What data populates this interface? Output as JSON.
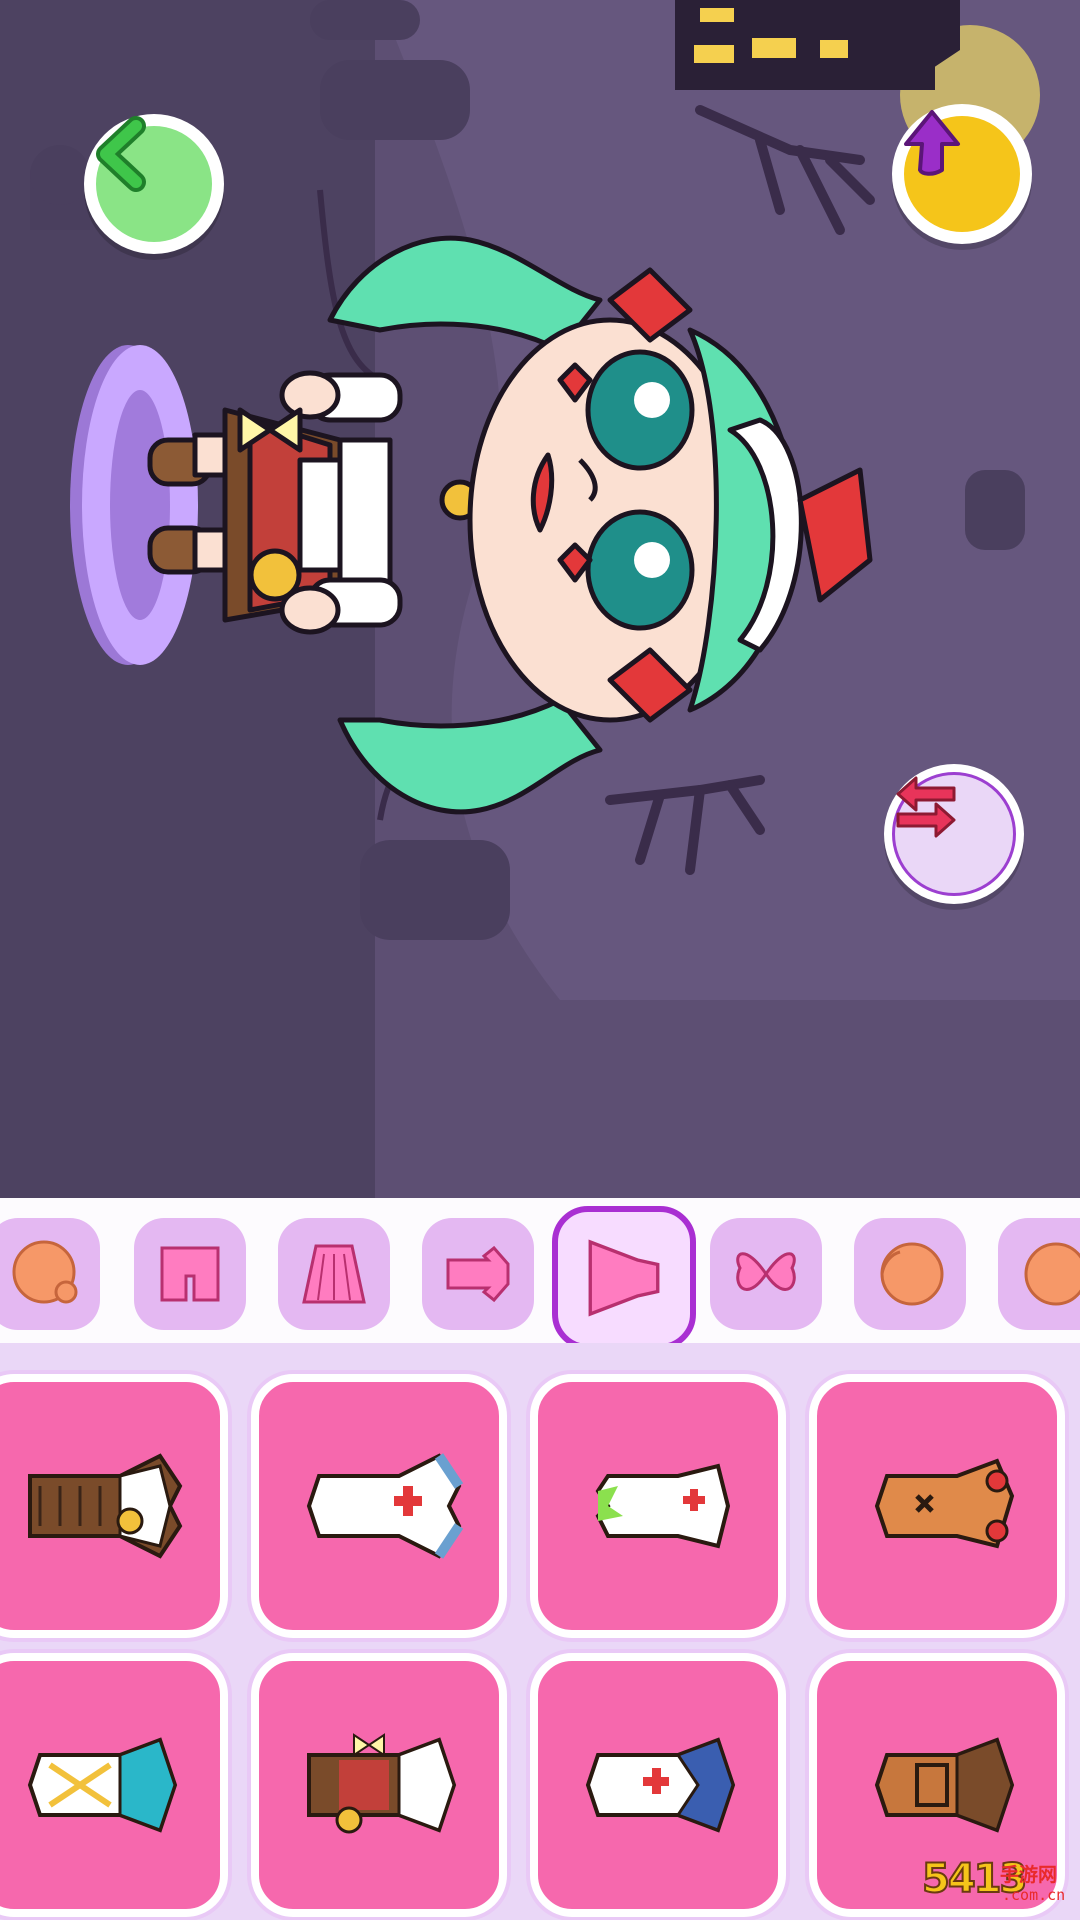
{
  "scene": {
    "back_button": {
      "icon": "chevron-left-icon",
      "color": "#3fc64a"
    },
    "share_button": {
      "icon": "arrow-up-icon",
      "color": "#9a2ec8"
    },
    "swap_button": {
      "icon": "swap-arrows-icon",
      "color": "#e8345a"
    },
    "character": {
      "hair_color": "#5fe0b0",
      "eye_color": "#1f8f8a",
      "ribbon_color": "#e3383a"
    }
  },
  "category_tabs": [
    {
      "name": "face",
      "icon": "face-icon",
      "active": false
    },
    {
      "name": "shorts",
      "icon": "shorts-icon",
      "active": false
    },
    {
      "name": "skirt",
      "icon": "skirt-icon",
      "active": false
    },
    {
      "name": "top",
      "icon": "shirt-icon",
      "active": false
    },
    {
      "name": "dress",
      "icon": "dress-icon",
      "active": true
    },
    {
      "name": "wings",
      "icon": "butterfly-wings-icon",
      "active": false
    },
    {
      "name": "head",
      "icon": "head-icon",
      "active": false
    },
    {
      "name": "head-2",
      "icon": "head-icon",
      "active": false
    }
  ],
  "outfits": [
    {
      "name": "steampunk-brown-dress",
      "icon": "steampunk-dress-icon",
      "primary": "#7a4b2a",
      "secondary": "#f2c13b"
    },
    {
      "name": "nurse-dress",
      "icon": "nurse-dress-icon",
      "primary": "#ffffff",
      "secondary": "#e3383a"
    },
    {
      "name": "zombie-nurse-dress",
      "icon": "zombie-nurse-dress-icon",
      "primary": "#ffffff",
      "secondary": "#8be04e"
    },
    {
      "name": "orange-bow-dress",
      "icon": "orange-dress-icon",
      "primary": "#e08a4a",
      "secondary": "#e3383a"
    },
    {
      "name": "egyptian-dress",
      "icon": "egyptian-dress-icon",
      "primary": "#ffffff",
      "secondary": "#2ab7c9"
    },
    {
      "name": "steampunk-red-dress",
      "icon": "steampunk-red-dress-icon",
      "primary": "#7a4b2a",
      "secondary": "#e3383a"
    },
    {
      "name": "sailor-dress",
      "icon": "sailor-dress-icon",
      "primary": "#ffffff",
      "secondary": "#3a5eb0"
    },
    {
      "name": "brown-coat",
      "icon": "brown-coat-icon",
      "primary": "#c7773d",
      "secondary": "#7a4b2a"
    }
  ],
  "watermark": {
    "brand": "5413",
    "site_cn": "手游网",
    "domain": ".com.cn"
  }
}
